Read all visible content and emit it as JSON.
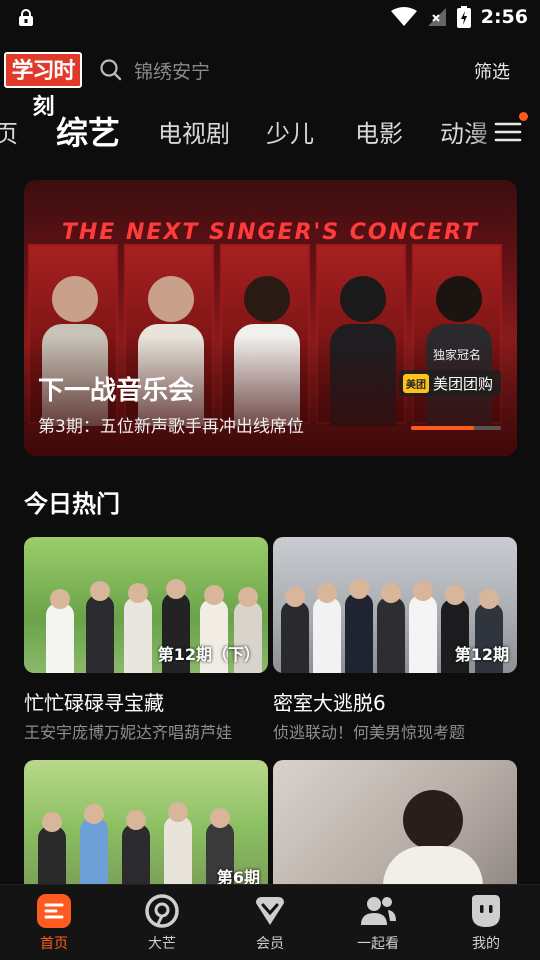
{
  "status_bar": {
    "time": "2:56"
  },
  "header": {
    "logo_text": "学习时刻",
    "search_placeholder": "锦绣安宁",
    "filter_label": "筛选"
  },
  "tabs": [
    {
      "label": "页",
      "active": false
    },
    {
      "label": "综艺",
      "active": true
    },
    {
      "label": "电视剧",
      "active": false
    },
    {
      "label": "少儿",
      "active": false
    },
    {
      "label": "电影",
      "active": false
    },
    {
      "label": "动漫",
      "active": false
    }
  ],
  "banner": {
    "concert_title": "THE NEXT SINGER'S CONCERT",
    "title": "下一战音乐会",
    "subtitle": "第3期：五位新声歌手再冲出线席位",
    "exclusive": "独家冠名",
    "sponsor_badge": "美团",
    "sponsor": "美团团购",
    "progress": 0.7
  },
  "section": {
    "title": "今日热门"
  },
  "cards": [
    {
      "name": "忙忙碌碌寻宝藏",
      "desc": "王安宇庞博万妮达齐唱葫芦娃",
      "episode": "第12期（下）"
    },
    {
      "name": "密室大逃脱6",
      "desc": "侦逃联动！何美男惊现考题",
      "episode": "第12期"
    },
    {
      "name": "",
      "desc": "",
      "episode": "第6期"
    },
    {
      "name": "",
      "desc": "",
      "episode": ""
    }
  ],
  "bottom_nav": [
    {
      "label": "首页",
      "icon": "home-icon",
      "active": true
    },
    {
      "label": "大芒",
      "icon": "mango-icon",
      "active": false
    },
    {
      "label": "会员",
      "icon": "vip-heart-icon",
      "active": false
    },
    {
      "label": "一起看",
      "icon": "watch-together-icon",
      "active": false
    },
    {
      "label": "我的",
      "icon": "profile-icon",
      "active": false
    }
  ],
  "colors": {
    "accent": "#ff5a1f",
    "background": "#0d0d0d"
  }
}
